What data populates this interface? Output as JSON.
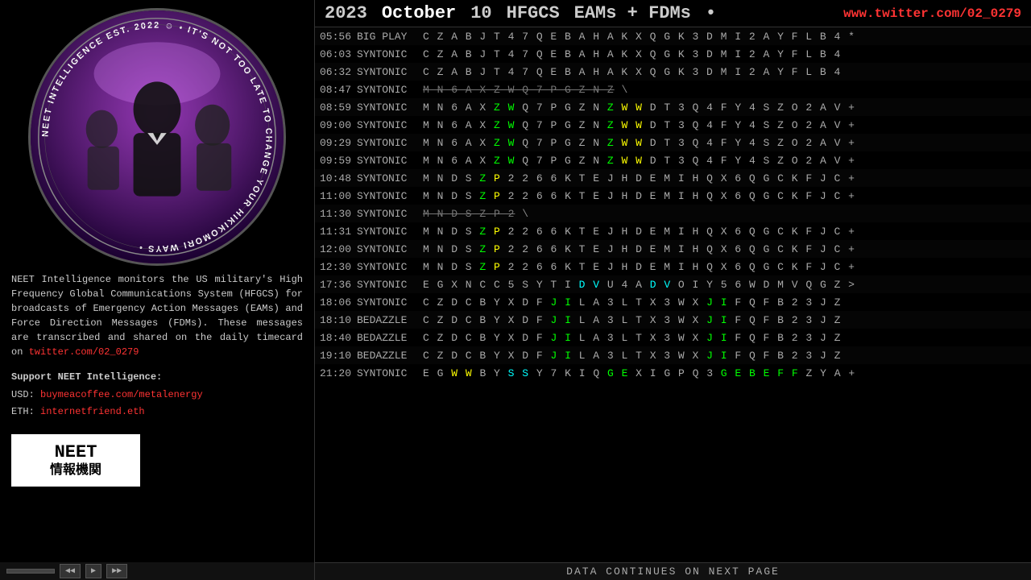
{
  "header": {
    "year": "2023",
    "month": "October",
    "day": "10",
    "system": "HFGCS",
    "types": "EAMs + FDMs",
    "bullet": "•",
    "twitter": "www.twitter.com/02_0279"
  },
  "left": {
    "circle_text": "NEET INTELLIGENCE EST. 2022 • IT'S NOT TOO LATE TO CHANGE YOUR HIKIKOMORI WAYS ☺ •",
    "description": "NEET Intelligence monitors the US military's High Frequency Global Communications System (HFGCS) for broadcasts of Emergency Action Messages (EAMs) and Force Direction Messages (FDMs). These messages are transcribed and shared on the daily timecard on",
    "twitter_text": "twitter.com/02_0279",
    "twitter_url": "twitter.com/02_0279",
    "support_title": "Support NEET Intelligence:",
    "usd_label": "USD:",
    "usd_link": "buymeacoffee.com/metalenergy",
    "eth_label": "ETH:",
    "eth_link": "internetfriend.eth",
    "logo_line1": "NEET",
    "logo_line2": "情報機関"
  },
  "footer": {
    "text": "DATA CONTINUES ON NEXT PAGE"
  },
  "rows": [
    {
      "time": "05:56",
      "station": "BIG PLAY",
      "codes": "C Z A B J T 4 7 Q E B A H A K X Q G K 3 D M I 2 A Y F L B 4 *",
      "highlights": []
    },
    {
      "time": "06:03",
      "station": "SYNTONIC",
      "codes": "C Z A B J T 4 7 Q E B A H A K X Q G K 3 D M I 2 A Y F L B 4",
      "highlights": []
    },
    {
      "time": "06:32",
      "station": "SYNTONIC",
      "codes": "C Z A B J T 4 7 Q E B A H A K X Q G K 3 D M I 2 A Y F L B 4",
      "highlights": []
    },
    {
      "time": "08:47",
      "station": "SYNTONIC",
      "codes": "~~M N 6 A X Z W Q 7 P G Z N Z~~",
      "highlights": [],
      "special": "strikethrough_partial",
      "suffix": "\\"
    },
    {
      "time": "08:59",
      "station": "SYNTONIC",
      "codes": "M N 6 A X Z W Q 7 P G Z N Z W W D T 3 Q 4 F Y 4 S Z O 2 A V +",
      "highlights": [
        "Z",
        "W",
        "W"
      ]
    },
    {
      "time": "09:00",
      "station": "SYNTONIC",
      "codes": "M N 6 A X Z W Q 7 P G Z N Z W W D T 3 Q 4 F Y 4 S Z O 2 A V +",
      "highlights": []
    },
    {
      "time": "09:29",
      "station": "SYNTONIC",
      "codes": "M N 6 A X Z W Q 7 P G Z N Z W W D T 3 Q 4 F Y 4 S Z O 2 A V +",
      "highlights": []
    },
    {
      "time": "09:59",
      "station": "SYNTONIC",
      "codes": "M N 6 A X Z W Q 7 P G Z N Z W W D T 3 Q 4 F Y 4 S Z O 2 A V +",
      "highlights": []
    },
    {
      "time": "10:48",
      "station": "SYNTONIC",
      "codes": "M N D S Z P 2 2 6 6 K T E J H D E M I H Q X 6 Q G C K F J C +",
      "highlights": []
    },
    {
      "time": "11:00",
      "station": "SYNTONIC",
      "codes": "M N D S Z P 2 2 6 6 K T E J H D E M I H Q X 6 Q G C K F J C +",
      "highlights": []
    },
    {
      "time": "11:30",
      "station": "SYNTONIC",
      "codes": "~~M N D S Z P 2~~",
      "special": "strikethrough",
      "suffix": "\\"
    },
    {
      "time": "11:31",
      "station": "SYNTONIC",
      "codes": "M N D S Z P 2 2 6 6 K T E J H D E M I H Q X 6 Q G C K F J C +",
      "highlights": []
    },
    {
      "time": "12:00",
      "station": "SYNTONIC",
      "codes": "M N D S Z P 2 2 6 6 K T E J H D E M I H Q X 6 Q G C K F J C +",
      "highlights": []
    },
    {
      "time": "12:30",
      "station": "SYNTONIC",
      "codes": "M N D S Z P 2 2 6 6 K T E J H D E M I H Q X 6 Q G C K F J C +",
      "highlights": []
    },
    {
      "time": "17:36",
      "station": "SYNTONIC",
      "codes": "E G X N C C 5 S Y T I D V U 4 A D V O I Y 5 6 W D M V Q G Z >",
      "highlights": [
        "D",
        "V",
        "D",
        "V"
      ]
    },
    {
      "time": "18:06",
      "station": "SYNTONIC",
      "codes": "C Z D C B Y X D F J I L A 3 L T X 3 W X J I F Q F B 2 3 J Z",
      "highlights": [
        "J",
        "I",
        "J",
        "I"
      ]
    },
    {
      "time": "18:10",
      "station": "BEDAZZLE",
      "codes": "C Z D C B Y X D F J I L A 3 L T X 3 W X J I F Q F B 2 3 J Z",
      "highlights": [
        "J",
        "I",
        "J",
        "I"
      ]
    },
    {
      "time": "18:40",
      "station": "BEDAZZLE",
      "codes": "C Z D C B Y X D F J I L A 3 L T X 3 W X J I F Q F B 2 3 J Z",
      "highlights": [
        "J",
        "I",
        "J",
        "I"
      ]
    },
    {
      "time": "19:10",
      "station": "BEDAZZLE",
      "codes": "C Z D C B Y X D F J I L A 3 L T X 3 W X J I F Q F B 2 3 J Z",
      "highlights": [
        "J",
        "I",
        "J",
        "I"
      ]
    },
    {
      "time": "21:20",
      "station": "SYNTONIC",
      "codes": "E G W W B Y S S Y 7 K I Q G E X I G P Q 3 G E B E F F Z Y A +",
      "highlights": [
        "W",
        "W",
        "S",
        "S",
        "G",
        "E",
        "B",
        "E",
        "F",
        "F"
      ]
    }
  ]
}
